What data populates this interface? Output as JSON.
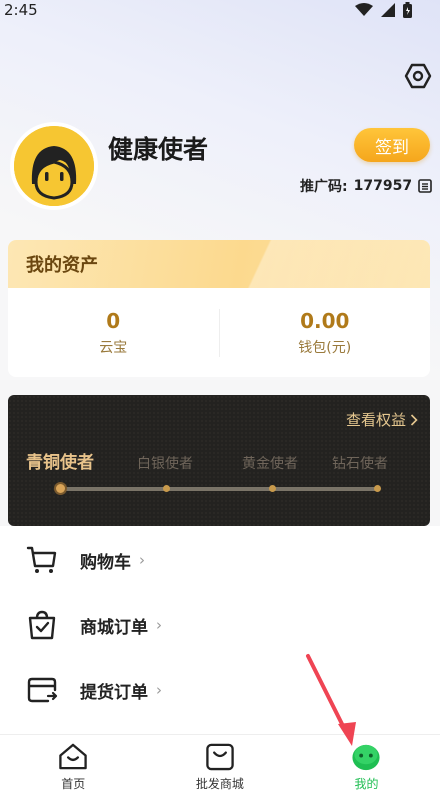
{
  "status_bar": {
    "time": "2:45"
  },
  "profile": {
    "username": "健康使者",
    "sign_in_label": "签到",
    "invite_code_label": "推广码:",
    "invite_code": "177957"
  },
  "assets": {
    "title": "我的资产",
    "items": [
      {
        "value": "0",
        "label": "云宝"
      },
      {
        "value": "0.00",
        "label": "钱包(元)"
      }
    ]
  },
  "level": {
    "view_rights_label": "查看权益",
    "levels": [
      "青铜使者",
      "白银使者",
      "黄金使者",
      "钻石使者"
    ],
    "current_index": 0
  },
  "menu": [
    {
      "label": "购物车",
      "icon": "cart-icon"
    },
    {
      "label": "商城订单",
      "icon": "order-bag-icon"
    },
    {
      "label": "提货订单",
      "icon": "pickup-order-icon"
    }
  ],
  "tabbar": [
    {
      "label": "首页",
      "icon": "home-icon"
    },
    {
      "label": "批发商城",
      "icon": "shopping-bag-icon"
    },
    {
      "label": "我的",
      "icon": "profile-mascot-icon",
      "active": true
    }
  ],
  "colors": {
    "accent_gold": "#f5a61c",
    "active_tab_green": "#1fbe52",
    "level_text_gold": "#e8c38b",
    "annotation_arrow": "#ef4453"
  }
}
